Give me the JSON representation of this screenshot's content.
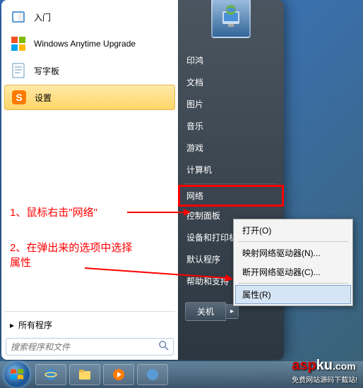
{
  "left_menu": {
    "items": [
      {
        "label": "入门",
        "icon": "📘"
      },
      {
        "label": "Windows Anytime Upgrade",
        "icon": "🪟"
      },
      {
        "label": "写字板",
        "icon": "📄"
      },
      {
        "label": "设置",
        "icon": "S",
        "highlighted": true
      }
    ],
    "all_programs": "所有程序",
    "search_placeholder": "搜索程序和文件"
  },
  "right_menu": {
    "items": [
      "印鸿",
      "文档",
      "图片",
      "音乐",
      "游戏",
      "计算机",
      "网络",
      "控制面板",
      "设备和打印机",
      "默认程序",
      "帮助和支持"
    ],
    "boxed_index": 6,
    "shutdown": "关机"
  },
  "context_menu": {
    "items": [
      "打开(O)",
      "映射网络驱动器(N)...",
      "断开网络驱动器(C)...",
      "属性(R)"
    ],
    "hovered_index": 3
  },
  "annotations": {
    "line1": "1、鼠标右击\"网络\"",
    "line2": "2、在弹出来的选项中选择属性"
  },
  "watermark": {
    "main1": "asp",
    "main2": "ku",
    "suffix": ".com",
    "sub": "免费网站源码下载站!"
  }
}
